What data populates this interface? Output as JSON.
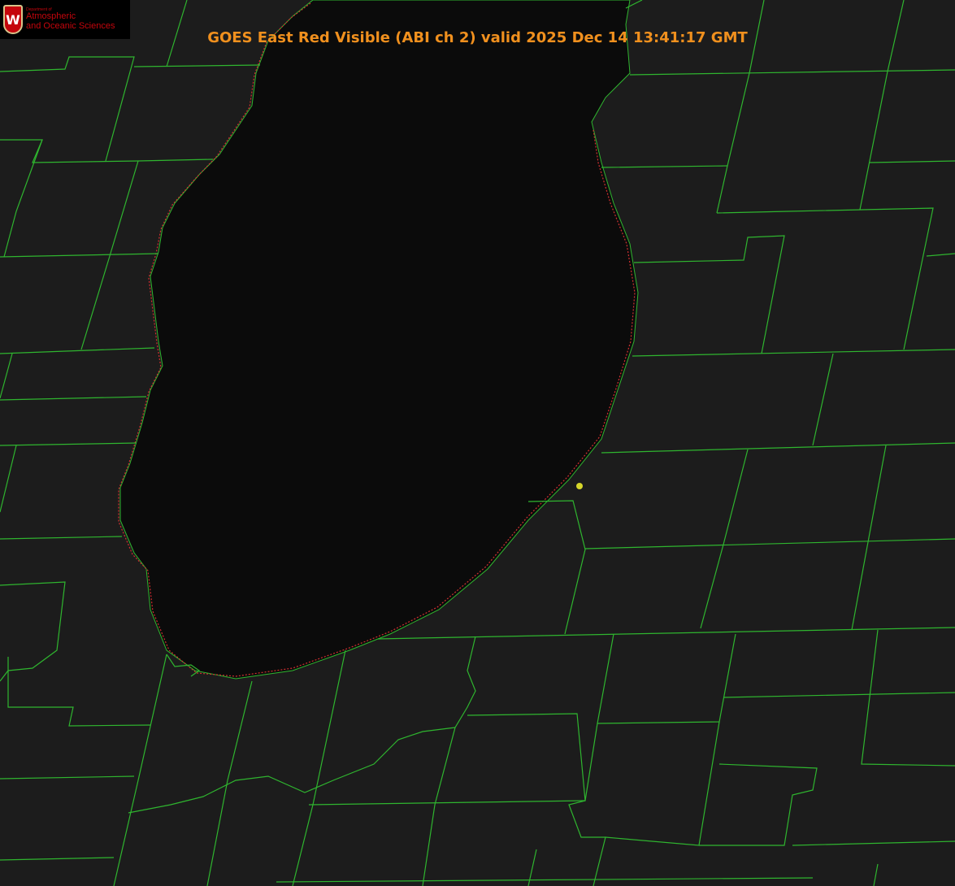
{
  "title": "GOES East Red Visible (ABI ch 2) valid 2025 Dec 14 13:41:17 GMT",
  "logo": {
    "letter": "W",
    "line1": "Department of",
    "line2": "Atmospheric",
    "line3": "and Oceanic Sciences"
  },
  "colors": {
    "county_lines": "#2fb52f",
    "shoreline": "#d03030",
    "title": "#f0901e",
    "marker": "#d6d62a",
    "lake": "#0b0b0b",
    "land": "#1c1c1c"
  }
}
